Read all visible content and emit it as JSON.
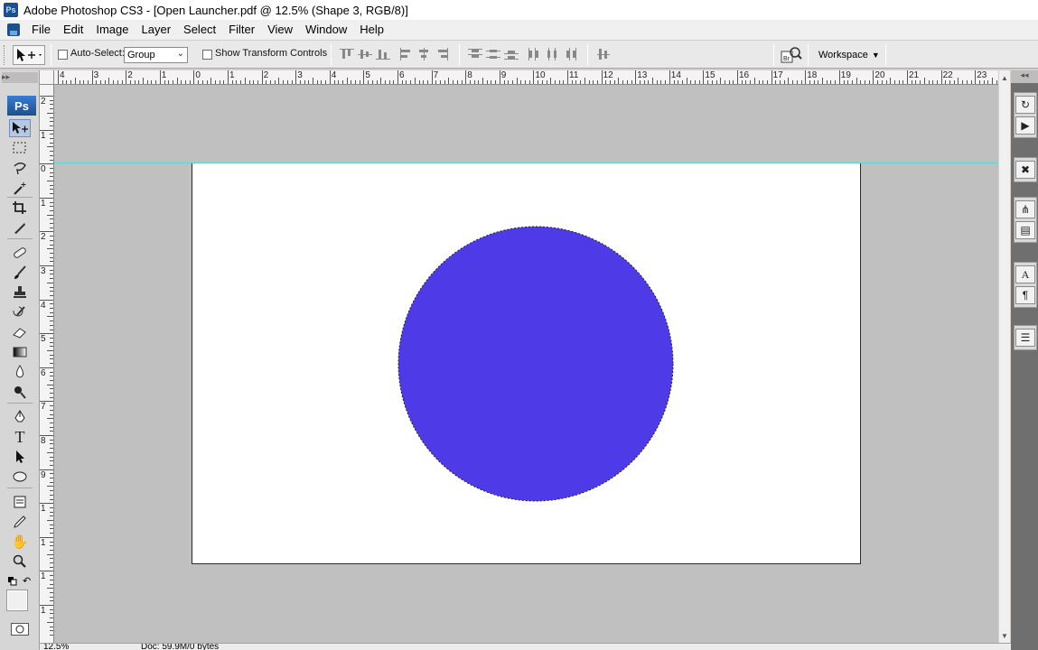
{
  "window": {
    "title": "Adobe Photoshop CS3 - [Open Launcher.pdf @ 12.5% (Shape 3, RGB/8)]",
    "app_badge": "Ps"
  },
  "menu": {
    "items": [
      "File",
      "Edit",
      "Image",
      "Layer",
      "Select",
      "Filter",
      "View",
      "Window",
      "Help"
    ]
  },
  "options_bar": {
    "auto_select_label": "Auto-Select:",
    "auto_select_value": "Group",
    "show_transform_label": "Show Transform Controls",
    "workspace_label": "Workspace",
    "auto_select_checked": false,
    "show_transform_checked": false
  },
  "toolbox": {
    "badge": "Ps",
    "active_tool": "move-tool"
  },
  "rulers": {
    "top_numbers": [
      "4",
      "3",
      "2",
      "1",
      "0",
      "1",
      "2",
      "3",
      "4",
      "5",
      "6",
      "7",
      "8",
      "9",
      "10",
      "11",
      "12",
      "13",
      "14",
      "15",
      "16",
      "17",
      "18",
      "19",
      "20",
      "21",
      "22",
      "23"
    ],
    "left_numbers": [
      "2",
      "1",
      "0",
      "1",
      "2",
      "3",
      "4",
      "5",
      "6",
      "7",
      "8",
      "9",
      "1",
      "1",
      "1",
      "1"
    ]
  },
  "document": {
    "background_color": "#ffffff",
    "shape": {
      "type": "circle",
      "fill": "#4f3ae8",
      "selection_outline": "marching-ants"
    },
    "guide_color": "#5fd6d6"
  },
  "status": {
    "zoom": "12.5%",
    "doc_info": "Doc: 59.9M/0 bytes"
  },
  "colors": {
    "canvas_bg": "#c0c0c0",
    "dock_bg": "#6f6f6f",
    "accent": "#1d4f8c"
  }
}
